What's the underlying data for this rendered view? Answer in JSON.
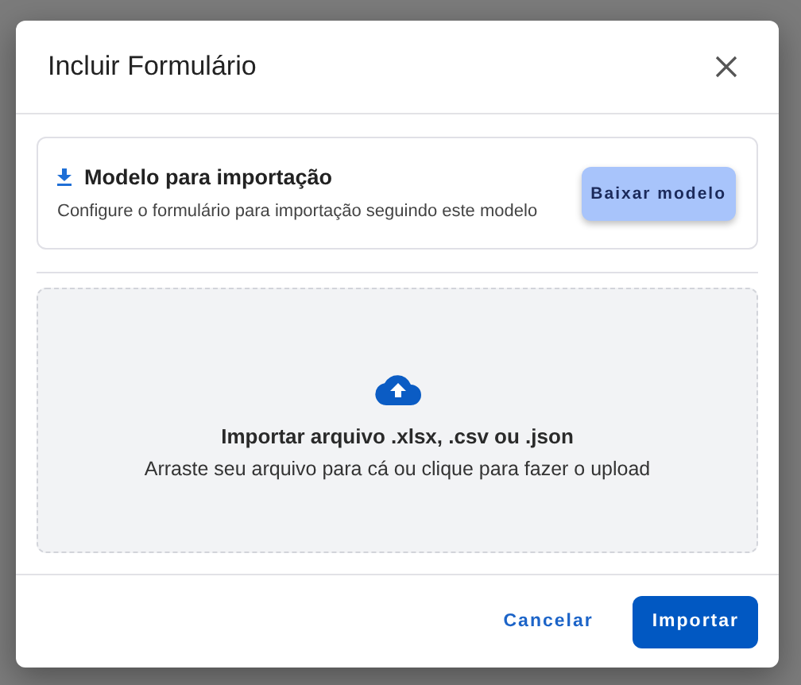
{
  "dialog": {
    "title": "Incluir Formulário"
  },
  "template": {
    "title": "Modelo para importação",
    "description": "Configure o formulário para importação seguindo este modelo",
    "button": "Baixar modelo"
  },
  "dropzone": {
    "title": "Importar arquivo .xlsx, .csv ou .json",
    "hint": "Arraste seu arquivo para cá ou clique para fazer o upload"
  },
  "buttons": [
    {
      "label": "Cancelar",
      "kind": "text"
    },
    {
      "label": "Importar",
      "kind": "primary"
    }
  ]
}
